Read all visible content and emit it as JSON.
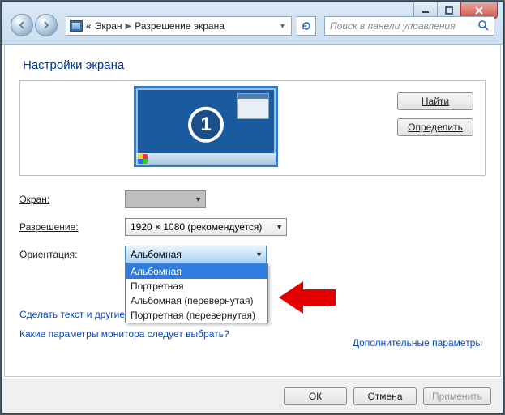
{
  "breadcrumb": {
    "prefix": "«",
    "seg1": "Экран",
    "seg2": "Разрешение экрана"
  },
  "search": {
    "placeholder": "Поиск в панели управления"
  },
  "page": {
    "title": "Настройки экрана"
  },
  "preview": {
    "monitor_number": "1",
    "btn_find": "Найти",
    "btn_detect": "Определить"
  },
  "labels": {
    "screen": "Экран:",
    "resolution": "Разрешение:",
    "orientation": "Ориентация:"
  },
  "values": {
    "resolution": "1920 × 1080 (рекомендуется)",
    "orientation_selected": "Альбомная"
  },
  "orientation_options": [
    "Альбомная",
    "Портретная",
    "Альбомная (перевернутая)",
    "Портретная (перевернутая)"
  ],
  "links": {
    "text_size_truncated": "Сделать текст и другие",
    "which_monitor": "Какие параметры монитора следует выбрать?",
    "advanced": "Дополнительные параметры"
  },
  "footer": {
    "ok": "ОК",
    "cancel": "Отмена",
    "apply": "Применить"
  }
}
